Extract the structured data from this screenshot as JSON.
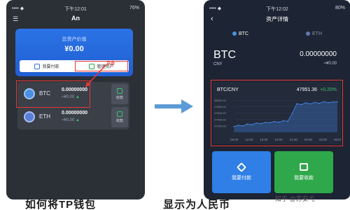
{
  "left_phone": {
    "status": {
      "left": "•••• ◆",
      "time": "下午12:01",
      "right": "76%"
    },
    "header": {
      "menu_icon": "menu-icon",
      "title": "An"
    },
    "asset_card": {
      "label": "总资产价值",
      "value": "¥0.00"
    },
    "buttons": {
      "send": "我要付款",
      "manage": "管理资产"
    },
    "callout": "点击",
    "coins": [
      {
        "symbol": "BTC",
        "amount": "0.00000000",
        "fiat": "≈¥0.00",
        "trend": "▲",
        "receive": "收款"
      },
      {
        "symbol": "ETH",
        "amount": "0.00000000",
        "fiat": "≈¥0.00",
        "trend": "▲",
        "receive": "收款"
      }
    ]
  },
  "right_phone": {
    "status": {
      "left": "•••• ◆",
      "time": "下午12:02",
      "right": "80%"
    },
    "header": {
      "back": "‹",
      "title": "资产详情"
    },
    "tabs": [
      {
        "label": "BTC"
      },
      {
        "label": "ETH"
      }
    ],
    "coin": {
      "symbol": "BTC",
      "currency": "CNY",
      "amount": "0.00000000",
      "fiat": "≈¥0.00"
    },
    "chart_header": {
      "pair": "BTC/CNY",
      "price": "47951.36",
      "change": "+0.20%"
    },
    "actions": {
      "send": "我要付款",
      "receive": "我要收款"
    }
  },
  "chart_data": {
    "type": "area",
    "x": [
      "09:00",
      "10:00",
      "11:00",
      "12:00",
      "13:00",
      "14:00",
      "15:00",
      "16:00",
      "17:00",
      "18:00",
      "19:00",
      "20:00",
      "21:00",
      "22:00",
      "23:00",
      "00:00",
      "01:00",
      "02:00",
      "03:00",
      "04:00",
      "05:00",
      "06:00",
      "07:00",
      "08:00"
    ],
    "values": [
      47180,
      47220,
      47200,
      47260,
      47240,
      47290,
      47270,
      47310,
      47300,
      47340,
      47320,
      47360,
      47350,
      47600,
      47900,
      47870,
      47930,
      47890,
      47940,
      47910,
      47960,
      47930,
      47950,
      47951
    ],
    "ylim": [
      47000,
      48100
    ],
    "y_ticks": [
      "48000.00",
      "47800.00",
      "47600.00",
      "47400.00",
      "47200.00"
    ],
    "x_ticks": [
      "09:00",
      "12:00",
      "15:00",
      "18:00",
      "21:00",
      "00:00",
      "03:00",
      "06:00"
    ],
    "grid": true,
    "color": "#3b7ddd"
  },
  "caption": {
    "part1": "如何将TP钱包",
    "part2": "显示为人民币"
  },
  "watermark": "知乎 @苏安弋",
  "colors": {
    "red_highlight": "#e53935",
    "blue": "#2f7fe6",
    "green": "#2ea84a"
  }
}
